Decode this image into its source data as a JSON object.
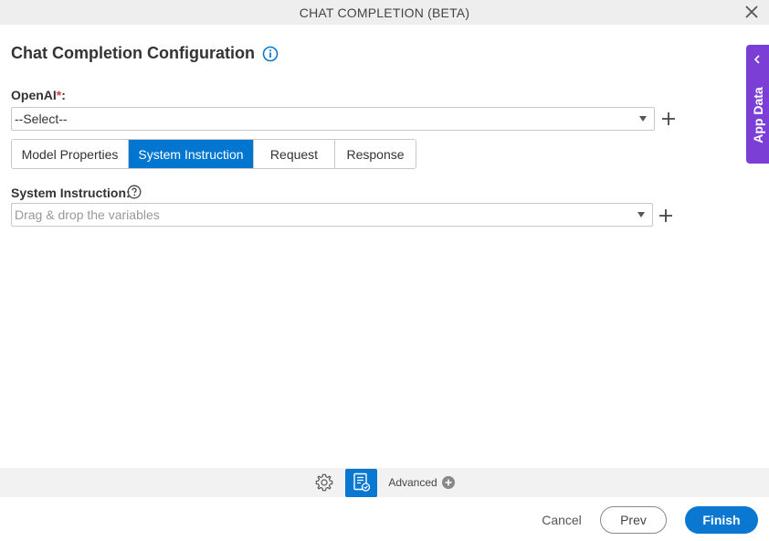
{
  "window": {
    "title": "CHAT COMPLETION (BETA)"
  },
  "heading": {
    "title": "Chat Completion Configuration"
  },
  "openai": {
    "label": "OpenAI",
    "required_mark": "*",
    "colon": ":",
    "selected": "--Select--"
  },
  "tabs": [
    {
      "label": "Model Properties",
      "active": false
    },
    {
      "label": "System Instruction",
      "active": true
    },
    {
      "label": "Request",
      "active": false
    },
    {
      "label": "Response",
      "active": false
    }
  ],
  "system_instruction": {
    "label": "System Instruction:",
    "placeholder": "Drag & drop the variables"
  },
  "side_panel": {
    "label": "App Data"
  },
  "toolbar": {
    "advanced_label": "Advanced"
  },
  "footer": {
    "cancel": "Cancel",
    "prev": "Prev",
    "finish": "Finish"
  },
  "colors": {
    "primary": "#0a77d1",
    "app_data": "#7b3fd6",
    "required": "#d9363e"
  },
  "icons": [
    "close-icon",
    "info-icon",
    "chevron-down-icon",
    "plus-icon",
    "help-icon",
    "chevron-left-icon",
    "gear-icon",
    "document-check-icon",
    "plus-circle-icon"
  ]
}
